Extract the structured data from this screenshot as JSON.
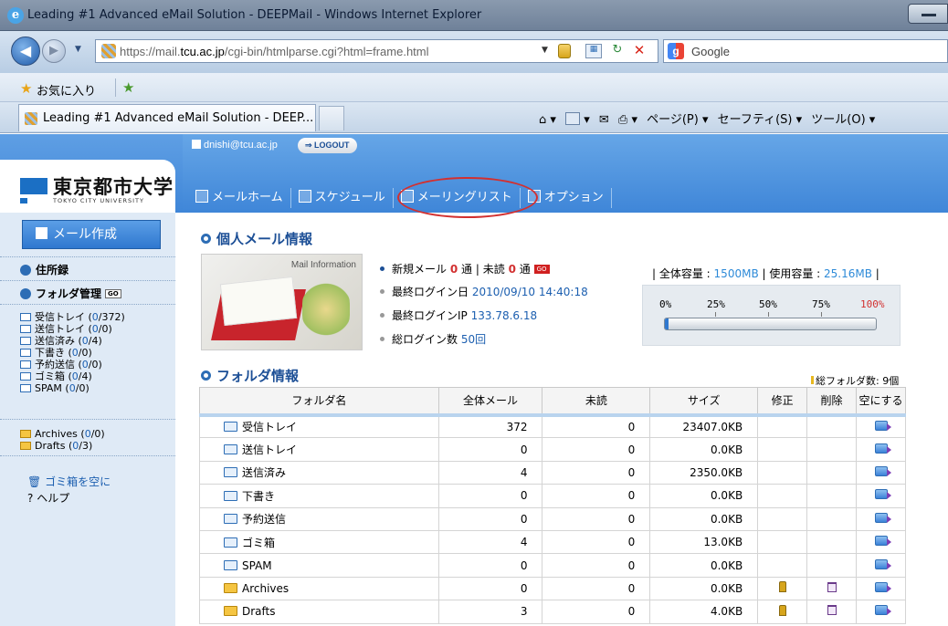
{
  "browser": {
    "window_title": "Leading #1 Advanced eMail Solution - DEEPMail - Windows Internet Explorer",
    "url_host": "https://mail.",
    "url_domain": "tcu.ac.jp",
    "url_path": "/cgi-bin/htmlparse.cgi?html=frame.html",
    "search_engine": "Google",
    "favorites_label": "お気に入り",
    "tab_title": "Leading #1 Advanced eMail Solution - DEEP...",
    "cmd_page": "ページ(P) ▾",
    "cmd_safety": "セーフティ(S) ▾",
    "cmd_tools": "ツール(O) ▾"
  },
  "header": {
    "logo_jp": "東京都市大学",
    "logo_en": "TOKYO CITY UNIVERSITY",
    "user_email": "dnishi@tcu.ac.jp",
    "logout_label": "⇒ LOGOUT",
    "nav": [
      {
        "label": "メールホーム",
        "icon": "home-icon"
      },
      {
        "label": "スケジュール",
        "icon": "calendar-icon"
      },
      {
        "label": "メーリングリスト",
        "icon": "mailing-list-icon"
      },
      {
        "label": "オプション",
        "icon": "options-icon"
      }
    ]
  },
  "sidebar": {
    "compose_label": "メール作成",
    "address_book_label": "住所録",
    "folder_manage_label": "フォルダ管理",
    "go_badge": "GO",
    "folders": [
      {
        "name": "受信トレイ",
        "unread": "0",
        "total": "/372)"
      },
      {
        "name": "送信トレイ",
        "unread": "0",
        "total": "/0)"
      },
      {
        "name": "送信済み",
        "unread": "0",
        "total": "/4)"
      },
      {
        "name": "下書き",
        "unread": "0",
        "total": "/0)"
      },
      {
        "name": "予約送信",
        "unread": "0",
        "total": "/0)"
      },
      {
        "name": "ゴミ箱",
        "unread": "0",
        "total": "/4)"
      },
      {
        "name": "SPAM",
        "unread": "0",
        "total": "/0)"
      }
    ],
    "user_folders": [
      {
        "name": "Archives",
        "unread": "0",
        "total": "/0)"
      },
      {
        "name": "Drafts",
        "unread": "0",
        "total": "/3)"
      }
    ],
    "empty_trash_label": "ゴミ箱を空に",
    "help_label": "ヘルプ"
  },
  "personal": {
    "section_title": "個人メール情報",
    "image_caption": "Mail Information",
    "new_mail_label": "新規メール",
    "new_mail_count": "0",
    "unit": "通",
    "unread_label": "未読",
    "unread_count": "0",
    "go_label": "GO",
    "last_login_label": "最終ログイン日",
    "last_login_value": "2010/09/10 14:40:18",
    "last_ip_label": "最終ログインIP",
    "last_ip_value": "133.78.6.18",
    "login_count_label": "総ログイン数",
    "login_count_value": "50回",
    "total_quota_label": "全体容量 : ",
    "total_quota_value": "1500MB",
    "used_quota_label": "使用容量 : ",
    "used_quota_value": "25.16MB",
    "usage_fraction": 0.0168,
    "ticks": [
      "0%",
      "25%",
      "50%",
      "75%",
      "100%"
    ]
  },
  "folders": {
    "section_title": "フォルダ情報",
    "total_label": "総フォルダ数: 9個",
    "columns": [
      "フォルダ名",
      "全体メール",
      "未読",
      "サイズ",
      "修正",
      "削除",
      "空にする"
    ],
    "rows": [
      {
        "name": "受信トレイ",
        "total": "372",
        "unread": "0",
        "size": "23407.0KB",
        "user": false
      },
      {
        "name": "送信トレイ",
        "total": "0",
        "unread": "0",
        "size": "0.0KB",
        "user": false
      },
      {
        "name": "送信済み",
        "total": "4",
        "unread": "0",
        "size": "2350.0KB",
        "user": false
      },
      {
        "name": "下書き",
        "total": "0",
        "unread": "0",
        "size": "0.0KB",
        "user": false
      },
      {
        "name": "予約送信",
        "total": "0",
        "unread": "0",
        "size": "0.0KB",
        "user": false
      },
      {
        "name": "ゴミ箱",
        "total": "4",
        "unread": "0",
        "size": "13.0KB",
        "user": false
      },
      {
        "name": "SPAM",
        "total": "0",
        "unread": "0",
        "size": "0.0KB",
        "user": false
      },
      {
        "name": "Archives",
        "total": "0",
        "unread": "0",
        "size": "0.0KB",
        "user": true
      },
      {
        "name": "Drafts",
        "total": "3",
        "unread": "0",
        "size": "4.0KB",
        "user": true
      }
    ]
  }
}
